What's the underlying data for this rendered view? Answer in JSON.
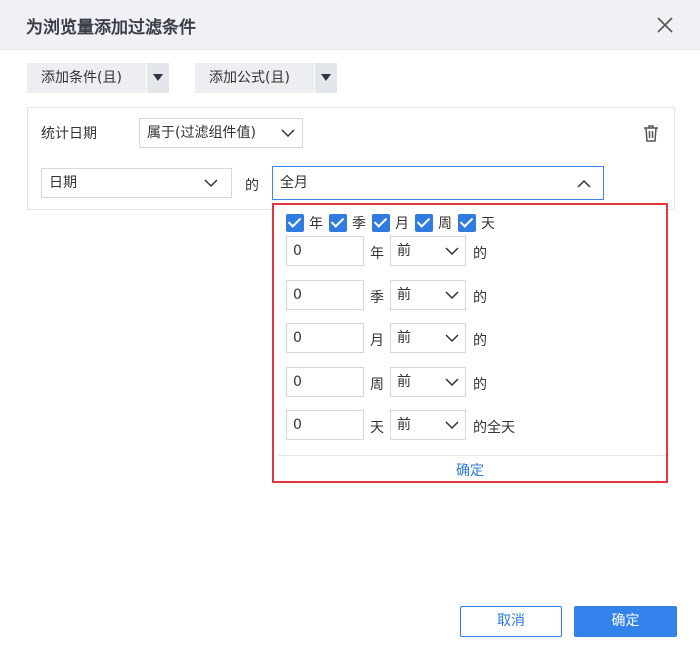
{
  "dialog": {
    "title": "为浏览量添加过滤条件"
  },
  "toolbar": {
    "add_condition": "添加条件(且)",
    "add_formula": "添加公式(且)"
  },
  "condition": {
    "field_label": "统计日期",
    "operator": "属于(过滤组件值)",
    "date_field": "日期",
    "of_label": "的",
    "range_value": "全月"
  },
  "popup": {
    "checkboxes": [
      {
        "label": "年",
        "checked": true
      },
      {
        "label": "季",
        "checked": true
      },
      {
        "label": "月",
        "checked": true
      },
      {
        "label": "周",
        "checked": true
      },
      {
        "label": "天",
        "checked": true
      }
    ],
    "rows": [
      {
        "value": "0",
        "unit": "年",
        "direction": "前",
        "suffix": "的"
      },
      {
        "value": "0",
        "unit": "季",
        "direction": "前",
        "suffix": "的"
      },
      {
        "value": "0",
        "unit": "月",
        "direction": "前",
        "suffix": "的"
      },
      {
        "value": "0",
        "unit": "周",
        "direction": "前",
        "suffix": "的"
      },
      {
        "value": "0",
        "unit": "天",
        "direction": "前",
        "suffix": "的全天"
      }
    ],
    "confirm": "确定"
  },
  "footer": {
    "cancel": "取消",
    "ok": "确定"
  },
  "colors": {
    "accent": "#2f7bdf",
    "highlight_border": "#e0383b"
  }
}
